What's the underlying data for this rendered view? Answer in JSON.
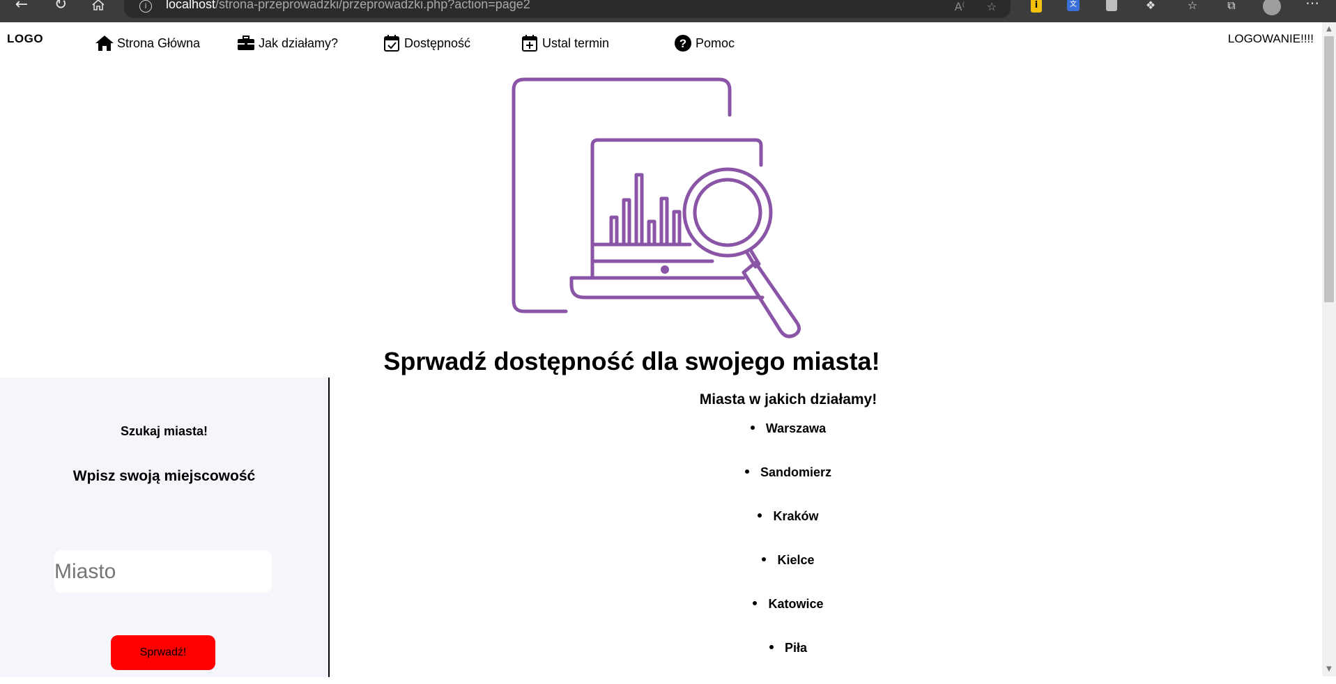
{
  "browser": {
    "url_host": "localhost",
    "url_path": "/strona-przeprowadzki/przeprowadzki.php?action=page2"
  },
  "header": {
    "logo": "LOGO",
    "login": "LOGOWANIE!!!!",
    "nav": [
      {
        "label": "Strona Główna",
        "icon": "home-icon"
      },
      {
        "label": "Jak działamy?",
        "icon": "briefcase-icon"
      },
      {
        "label": "Dostępność",
        "icon": "calendar-check-icon"
      },
      {
        "label": "Ustal termin",
        "icon": "calendar-plus-icon"
      },
      {
        "label": "Pomoc",
        "icon": "question-circle-icon"
      }
    ]
  },
  "hero": {
    "illustration": "laptop-magnifier-chart-illustration",
    "accent_color": "#8a55a6"
  },
  "main": {
    "title": "Sprwadź dostępność dla swojego miasta!"
  },
  "search": {
    "title": "Szukaj miasta!",
    "subtitle": "Wpisz swoją miejscowość",
    "placeholder": "Miasto",
    "value": "",
    "button_label": "Sprwadź!",
    "button_color": "#ff0000"
  },
  "cities": {
    "title": "Miasta w jakich działamy!",
    "items": [
      "Warszawa",
      "Sandomierz",
      "Kraków",
      "Kielce",
      "Katowice",
      "Piła"
    ]
  }
}
